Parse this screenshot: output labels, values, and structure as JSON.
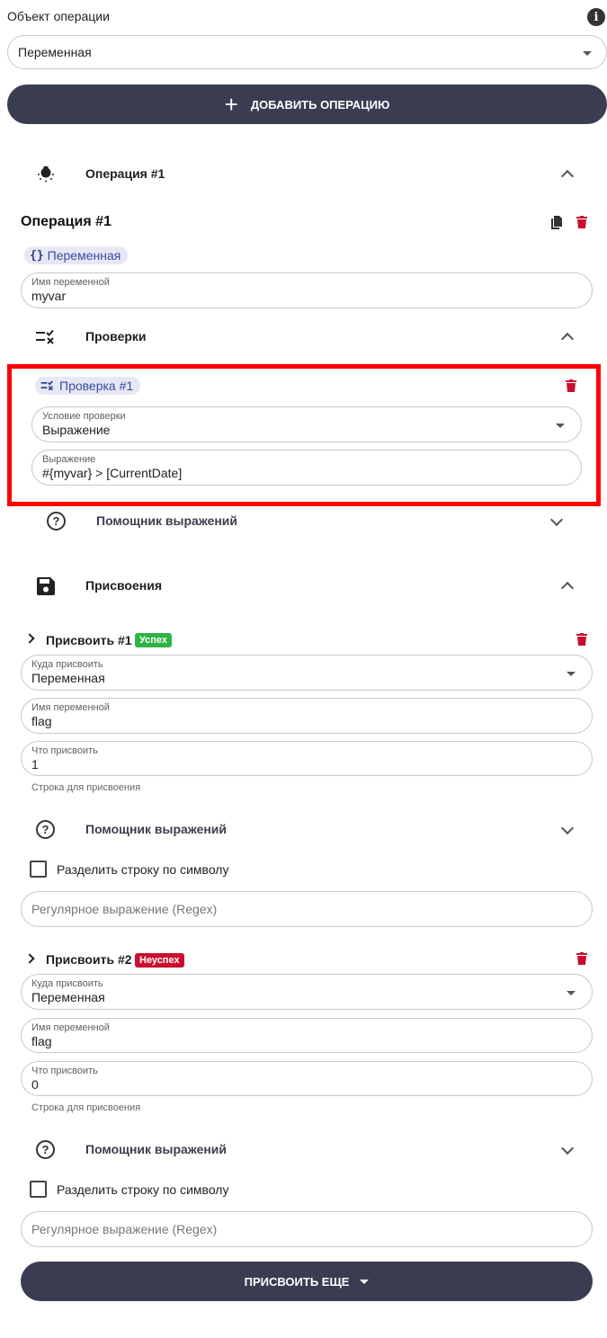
{
  "header": {
    "title": "Объект операции",
    "info_icon": "info-icon",
    "object_select_value": "Переменная",
    "add_button_label": "ДОБАВИТЬ ОПЕРАЦИЮ"
  },
  "operation": {
    "accordion_title": "Операция #1",
    "title": "Операция #1",
    "type_chip": "Переменная",
    "var_name_label": "Имя переменной",
    "var_name_value": "myvar"
  },
  "checks": {
    "section_title": "Проверки",
    "items": [
      {
        "chip": "Проверка #1",
        "condition_label": "Условие проверки",
        "condition_value": "Выражение",
        "expression_label": "Выражение",
        "expression_value": "#{myvar} > [CurrentDate]"
      }
    ],
    "helper_title": "Помощник выражений"
  },
  "assignments": {
    "section_title": "Присвоения",
    "items": [
      {
        "title": "Присвоить #1",
        "badge": "Успех",
        "badge_color": "#2fb344",
        "target_label": "Куда присвоить",
        "target_value": "Переменная",
        "var_label": "Имя переменной",
        "var_value": "flag",
        "what_label": "Что присвоить",
        "what_value": "1",
        "what_helper": "Строка для присвоения",
        "helper_title": "Помощник выражений",
        "split_label": "Разделить строку по символу",
        "regex_placeholder": "Регулярное выражение (Regex)"
      },
      {
        "title": "Присвоить #2",
        "badge": "Неуспех",
        "badge_color": "#c8102e",
        "target_label": "Куда присвоить",
        "target_value": "Переменная",
        "var_label": "Имя переменной",
        "var_value": "flag",
        "what_label": "Что присвоить",
        "what_value": "0",
        "what_helper": "Строка для присвоения",
        "helper_title": "Помощник выражений",
        "split_label": "Разделить строку по символу",
        "regex_placeholder": "Регулярное выражение (Regex)"
      }
    ],
    "more_button_label": "ПРИСВОИТЬ ЕЩЕ"
  },
  "colors": {
    "dark_button": "#3a3d52",
    "delete_red": "#c8102e",
    "highlight_border": "#ff0000",
    "chip_bg": "#e6e8f4"
  }
}
